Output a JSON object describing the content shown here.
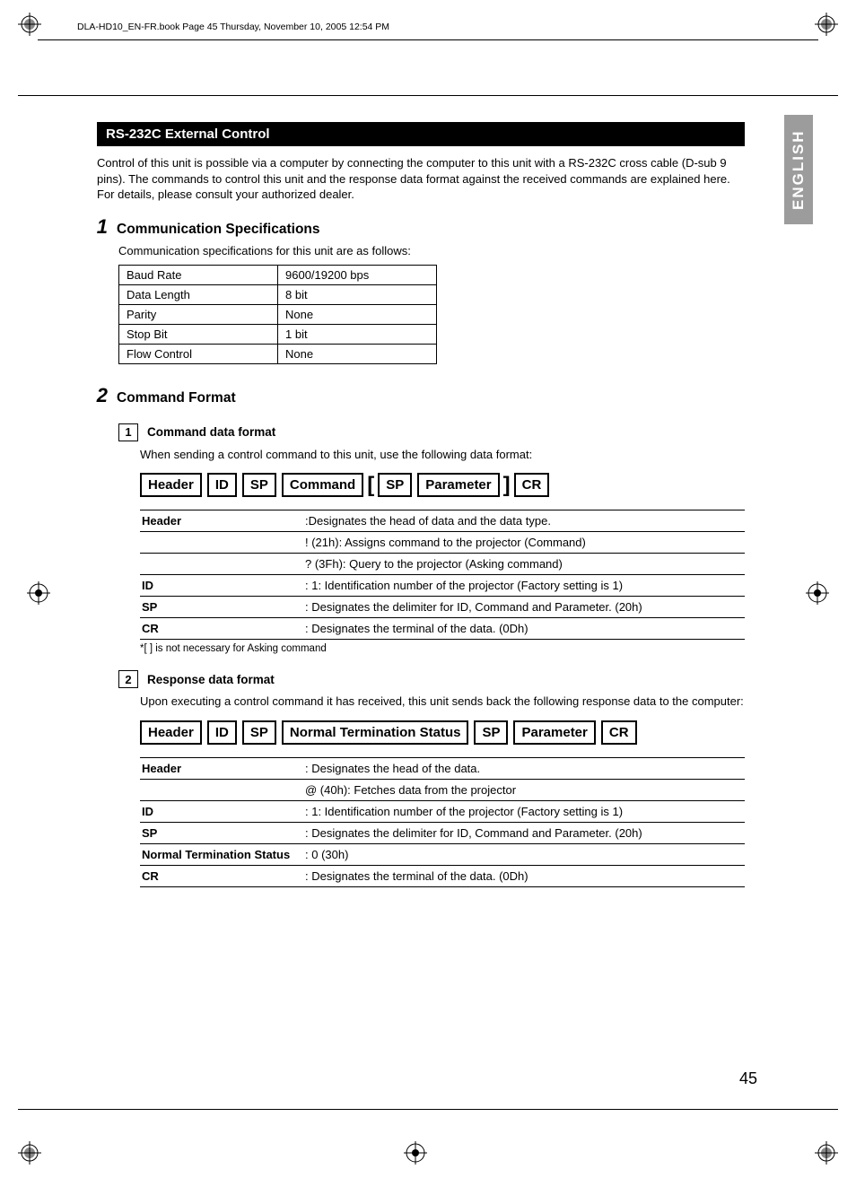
{
  "meta": {
    "header_stamp": "DLA-HD10_EN-FR.book  Page 45  Thursday, November 10, 2005  12:54 PM",
    "side_tab": "ENGLISH",
    "page_number": "45"
  },
  "title": "RS-232C External Control",
  "intro_p1": "Control of this unit is possible via a computer by connecting the computer to this unit with a RS-232C cross cable (D-sub 9 pins). The commands to control this unit and the response data format against the received commands are explained here.",
  "intro_p2": "For details, please consult your authorized dealer.",
  "sec1": {
    "num": "1",
    "title": "Communication Specifications",
    "desc": "Communication specifications for this unit are as follows:",
    "rows": [
      {
        "k": "Baud Rate",
        "v": "9600/19200 bps"
      },
      {
        "k": "Data Length",
        "v": "8 bit"
      },
      {
        "k": "Parity",
        "v": "None"
      },
      {
        "k": "Stop Bit",
        "v": "1 bit"
      },
      {
        "k": "Flow Control",
        "v": "None"
      }
    ]
  },
  "sec2": {
    "num": "2",
    "title": "Command Format",
    "sub1": {
      "num": "1",
      "title": "Command data format",
      "desc": "When sending a control command to this unit, use the following data format:",
      "tokens": [
        "Header",
        "ID",
        "SP",
        "Command",
        "SP",
        "Parameter",
        "CR"
      ],
      "brackets": [
        false,
        false,
        false,
        false,
        true,
        true,
        false
      ],
      "defs": [
        {
          "k": "Header",
          "v": ":Designates the head of data and the data type."
        },
        {
          "k": "",
          "v": "  ! (21h): Assigns command to the projector (Command)"
        },
        {
          "k": "",
          "v": "  ? (3Fh): Query to the projector (Asking command)"
        },
        {
          "k": "ID",
          "v": ": 1: Identification number of the projector (Factory setting is 1)"
        },
        {
          "k": "SP",
          "v": ": Designates the delimiter for ID, Command and Parameter. (20h)"
        },
        {
          "k": "CR",
          "v": ": Designates the terminal of the data. (0Dh)"
        }
      ],
      "footnote": "*[ ] is not necessary for Asking command"
    },
    "sub2": {
      "num": "2",
      "title": "Response data format",
      "desc": "Upon executing a control command it has received, this unit sends back the following response data to the computer:",
      "tokens": [
        "Header",
        "ID",
        "SP",
        "Normal Termination Status",
        "SP",
        "Parameter",
        "CR"
      ],
      "defs": [
        {
          "k": "Header",
          "v": ": Designates the head of the data."
        },
        {
          "k": "",
          "v": "  @ (40h): Fetches data from the projector"
        },
        {
          "k": "ID",
          "v": ": 1: Identification number of the projector (Factory setting is 1)"
        },
        {
          "k": "SP",
          "v": ": Designates the delimiter for ID, Command and Parameter. (20h)"
        },
        {
          "k": "Normal Termination Status",
          "v": ": 0 (30h)"
        },
        {
          "k": "CR",
          "v": ": Designates the terminal of the data. (0Dh)"
        }
      ]
    }
  }
}
